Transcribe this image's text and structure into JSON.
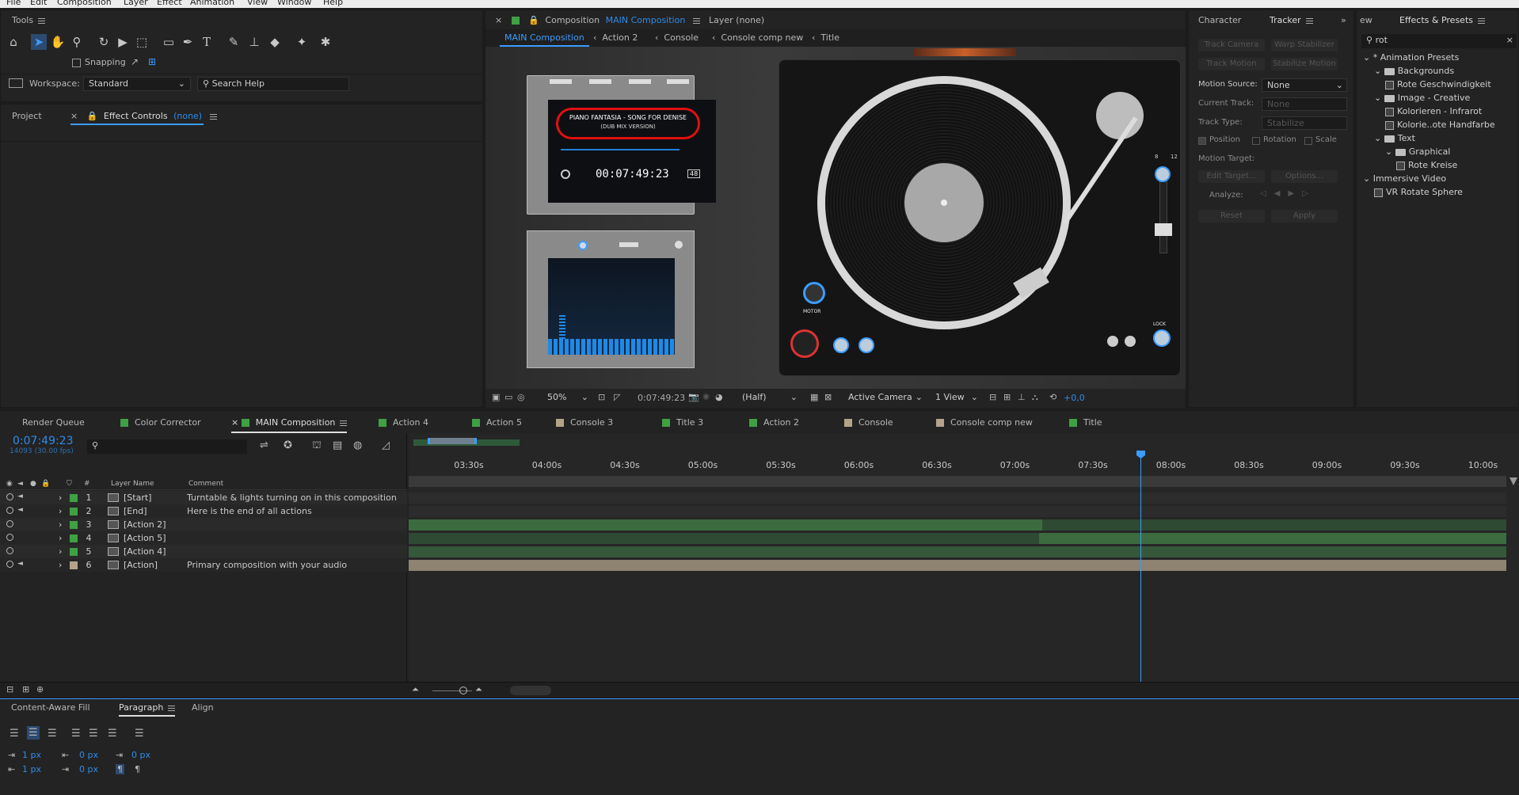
{
  "menu": [
    "File",
    "Edit",
    "Composition",
    "Layer",
    "Effect",
    "Animation",
    "View",
    "Window",
    "Help"
  ],
  "tools": {
    "title": "Tools",
    "snapping": "Snapping",
    "workspace_label": "Workspace:",
    "workspace_value": "Standard",
    "search_help": "Search Help"
  },
  "project": {
    "tab": "Project",
    "effect_controls": "Effect Controls",
    "effect_none": "(none)"
  },
  "comp": {
    "tab_prefix": "Composition",
    "tab_name": "MAIN Composition",
    "layer_tab": "Layer (none)",
    "breadcrumbs": [
      "MAIN Composition",
      "Action 2",
      "Console",
      "Console comp new",
      "Title"
    ],
    "display_title": "PIANO FANTASIA - SONG FOR DENISE",
    "display_sub": "(DUB MIX VERSION)",
    "display_time": "00:07:49:23",
    "display_vol": "48",
    "motor_label": "MOTOR",
    "lock_label": "LOCK",
    "speed_8": "8",
    "speed_12": "12"
  },
  "viewer": {
    "zoom": "50%",
    "timecode": "0:07:49:23",
    "quality": "(Half)",
    "camera": "Active Camera",
    "views": "1 View",
    "exposure": "+0,0"
  },
  "tracker": {
    "tab_character": "Character",
    "tab_tracker": "Tracker",
    "track_camera": "Track Camera",
    "warp_stabilizer": "Warp Stabilizer",
    "track_motion": "Track Motion",
    "stabilize_motion": "Stabilize Motion",
    "motion_source_label": "Motion Source:",
    "motion_source_value": "None",
    "current_track_label": "Current Track:",
    "current_track_value": "None",
    "track_type_label": "Track Type:",
    "track_type_value": "Stabilize",
    "position": "Position",
    "rotation": "Rotation",
    "scale": "Scale",
    "motion_target": "Motion Target:",
    "edit_target": "Edit Target...",
    "options": "Options...",
    "analyze": "Analyze:",
    "reset": "Reset",
    "apply": "Apply"
  },
  "effects": {
    "tab_prev": "ew",
    "tab": "Effects & Presets",
    "search_value": "rot",
    "items": [
      {
        "label": "* Animation Presets",
        "level": 0,
        "kind": "root"
      },
      {
        "label": "Backgrounds",
        "level": 1,
        "kind": "folder"
      },
      {
        "label": "Rote Geschwindigkeit",
        "level": 2,
        "kind": "preset"
      },
      {
        "label": "Image - Creative",
        "level": 1,
        "kind": "folder"
      },
      {
        "label": "Kolorieren - Infrarot",
        "level": 2,
        "kind": "preset"
      },
      {
        "label": "Kolorie..ote Handfarbe",
        "level": 2,
        "kind": "preset"
      },
      {
        "label": "Text",
        "level": 1,
        "kind": "folder"
      },
      {
        "label": "Graphical",
        "level": 2,
        "kind": "folder"
      },
      {
        "label": "Rote Kreise",
        "level": 3,
        "kind": "preset"
      },
      {
        "label": "Immersive Video",
        "level": 0,
        "kind": "root"
      },
      {
        "label": "VR Rotate Sphere",
        "level": 1,
        "kind": "preset"
      }
    ]
  },
  "timeline": {
    "tabs": [
      {
        "label": "Render Queue",
        "color": ""
      },
      {
        "label": "Color Corrector",
        "color": "#3fa044"
      },
      {
        "label": "MAIN Composition",
        "color": "#3fa044",
        "active": true
      },
      {
        "label": "Action 4",
        "color": "#3fa044"
      },
      {
        "label": "Action 5",
        "color": "#3fa044"
      },
      {
        "label": "Console 3",
        "color": "#b4a38a"
      },
      {
        "label": "Title 3",
        "color": "#3fa044"
      },
      {
        "label": "Action 2",
        "color": "#3fa044"
      },
      {
        "label": "Console",
        "color": "#b4a38a"
      },
      {
        "label": "Console comp new",
        "color": "#b4a38a"
      },
      {
        "label": "Title",
        "color": "#3fa044"
      }
    ],
    "timecode": "0:07:49:23",
    "frames": "14093 (30.00 fps)",
    "col_hash": "#",
    "col_layer_name": "Layer Name",
    "col_comment": "Comment",
    "ticks": [
      "03:30s",
      "04:00s",
      "04:30s",
      "05:00s",
      "05:30s",
      "06:00s",
      "06:30s",
      "07:00s",
      "07:30s",
      "08:00s",
      "08:30s",
      "09:00s",
      "09:30s",
      "10:00s"
    ],
    "layers": [
      {
        "num": "1",
        "name": "[Start]",
        "comment": "Turntable & lights turning on in this composition",
        "color": "#3fa044"
      },
      {
        "num": "2",
        "name": "[End]",
        "comment": "Here is the end of all actions",
        "color": "#3fa044"
      },
      {
        "num": "3",
        "name": "[Action 2]",
        "comment": "",
        "color": "#3fa044"
      },
      {
        "num": "4",
        "name": "[Action 5]",
        "comment": "",
        "color": "#3fa044"
      },
      {
        "num": "5",
        "name": "[Action 4]",
        "comment": "",
        "color": "#3fa044"
      },
      {
        "num": "6",
        "name": "[Action]",
        "comment": "Primary composition with your audio",
        "color": "#b4a38a"
      }
    ]
  },
  "bottom": {
    "content_aware": "Content-Aware Fill",
    "paragraph": "Paragraph",
    "align": "Align",
    "indent_left": "1 px",
    "space_before": "0 px",
    "indent_first": "0 px",
    "indent_right": "1 px",
    "space_after": "0 px"
  }
}
